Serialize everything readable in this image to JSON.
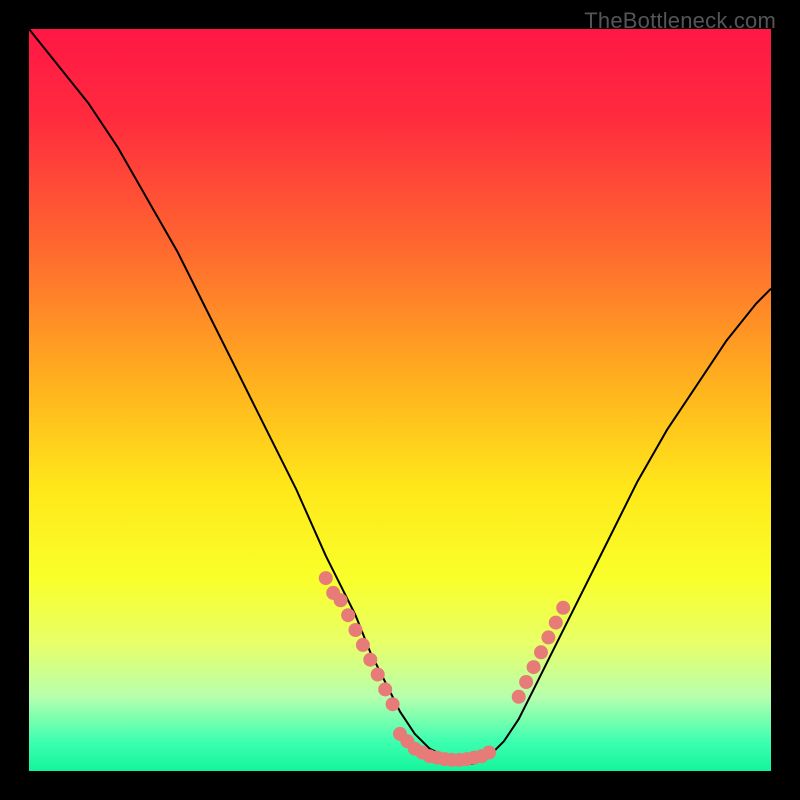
{
  "watermark": "TheBottleneck.com",
  "chart_data": {
    "type": "line",
    "title": "",
    "xlabel": "",
    "ylabel": "",
    "xlim": [
      0,
      100
    ],
    "ylim": [
      0,
      100
    ],
    "gradient_stops": [
      {
        "pct": 0,
        "color": "#ff1745"
      },
      {
        "pct": 12,
        "color": "#ff2b3e"
      },
      {
        "pct": 30,
        "color": "#ff6a2f"
      },
      {
        "pct": 48,
        "color": "#ffb21e"
      },
      {
        "pct": 62,
        "color": "#ffe81a"
      },
      {
        "pct": 74,
        "color": "#f9ff2a"
      },
      {
        "pct": 83,
        "color": "#e7ff6a"
      },
      {
        "pct": 90,
        "color": "#b6ffad"
      },
      {
        "pct": 96,
        "color": "#3dffb0"
      },
      {
        "pct": 100,
        "color": "#13f59b"
      }
    ],
    "series": [
      {
        "name": "left-curve",
        "style": "black-line",
        "points_xy": [
          [
            0,
            100
          ],
          [
            4,
            95
          ],
          [
            8,
            90
          ],
          [
            12,
            84
          ],
          [
            16,
            77
          ],
          [
            20,
            70
          ],
          [
            24,
            62
          ],
          [
            28,
            54
          ],
          [
            32,
            46
          ],
          [
            36,
            38
          ],
          [
            40,
            29
          ],
          [
            44,
            21
          ],
          [
            46,
            16
          ],
          [
            48,
            12
          ],
          [
            50,
            8
          ],
          [
            52,
            5
          ],
          [
            54,
            3
          ],
          [
            56,
            2
          ],
          [
            58,
            1
          ]
        ]
      },
      {
        "name": "right-curve",
        "style": "black-line",
        "points_xy": [
          [
            58,
            1
          ],
          [
            60,
            1
          ],
          [
            62,
            2
          ],
          [
            64,
            4
          ],
          [
            66,
            7
          ],
          [
            68,
            11
          ],
          [
            70,
            15
          ],
          [
            74,
            23
          ],
          [
            78,
            31
          ],
          [
            82,
            39
          ],
          [
            86,
            46
          ],
          [
            90,
            52
          ],
          [
            94,
            58
          ],
          [
            98,
            63
          ],
          [
            100,
            65
          ]
        ]
      },
      {
        "name": "left-dot-run",
        "style": "salmon-dots",
        "points_xy": [
          [
            40,
            26
          ],
          [
            41,
            24
          ],
          [
            42,
            23
          ],
          [
            43,
            21
          ],
          [
            44,
            19
          ],
          [
            45,
            17
          ],
          [
            46,
            15
          ],
          [
            47,
            13
          ],
          [
            48,
            11
          ],
          [
            49,
            9
          ]
        ]
      },
      {
        "name": "valley-dot-run",
        "style": "salmon-dots",
        "points_xy": [
          [
            50,
            5
          ],
          [
            51,
            4
          ],
          [
            52,
            3
          ],
          [
            53,
            2.5
          ],
          [
            54,
            2
          ],
          [
            55,
            1.8
          ],
          [
            56,
            1.6
          ],
          [
            57,
            1.5
          ],
          [
            58,
            1.5
          ],
          [
            59,
            1.6
          ],
          [
            60,
            1.8
          ],
          [
            61,
            2
          ],
          [
            62,
            2.5
          ]
        ]
      },
      {
        "name": "right-dot-run",
        "style": "salmon-dots",
        "points_xy": [
          [
            66,
            10
          ],
          [
            67,
            12
          ],
          [
            68,
            14
          ],
          [
            69,
            16
          ],
          [
            70,
            18
          ],
          [
            71,
            20
          ],
          [
            72,
            22
          ]
        ]
      }
    ]
  }
}
